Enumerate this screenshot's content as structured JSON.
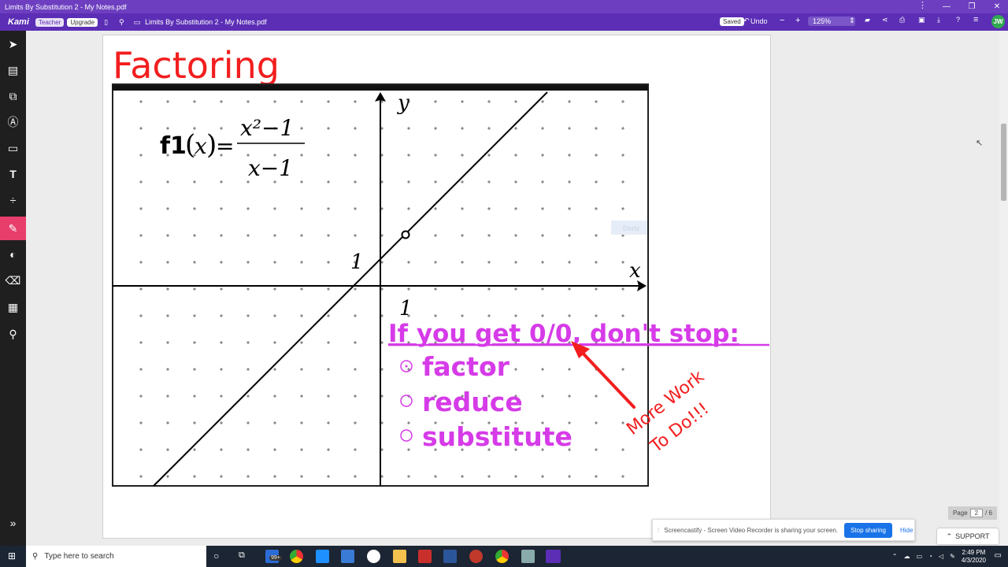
{
  "window": {
    "title": "Limits By Substitution 2 - My Notes.pdf"
  },
  "toolbar": {
    "app_name": "Kami",
    "teacher_label": "Teacher",
    "upgrade_label": "Upgrade",
    "doc_title": "Limits By Substitution 2 - My Notes.pdf",
    "saved_label": "Saved",
    "undo_label": "Undo",
    "zoom_value": "125%",
    "avatar_initials": "JW"
  },
  "sidebar": {
    "brush_size": "1",
    "colors": [
      "#3a3af0",
      "#f21e1e",
      "#d63be8"
    ]
  },
  "document": {
    "heading": "Factoring",
    "function_name": "f1",
    "numerator": "x²−1",
    "denominator": "x−1",
    "x_axis_label": "x",
    "y_axis_label": "y",
    "tick_x": "1",
    "tick_y": "1",
    "hidden_overlay": "Deriv",
    "rule_heading": "If you get 0/0, don't stop:",
    "steps": [
      "factor",
      "reduce",
      "substitute"
    ],
    "annotation_line1": "More Work",
    "annotation_line2": "To Do!!!"
  },
  "page_indicator": {
    "label": "Page",
    "current": "2",
    "total": "/ 6"
  },
  "support_label": "SUPPORT",
  "screencastify": {
    "message": "Screencastify - Screen Video Recorder is sharing your screen.",
    "stop_label": "Stop sharing",
    "hide_label": "Hide"
  },
  "taskbar": {
    "search_placeholder": "Type here to search",
    "mail_badge": "99+",
    "time": "2:49 PM",
    "date": "4/3/2020"
  },
  "colors": {
    "kami_purple": "#5b2eb5",
    "heading_red": "#f21e1e",
    "rule_magenta": "#d63be8",
    "pen_red": "#f21e1e"
  }
}
